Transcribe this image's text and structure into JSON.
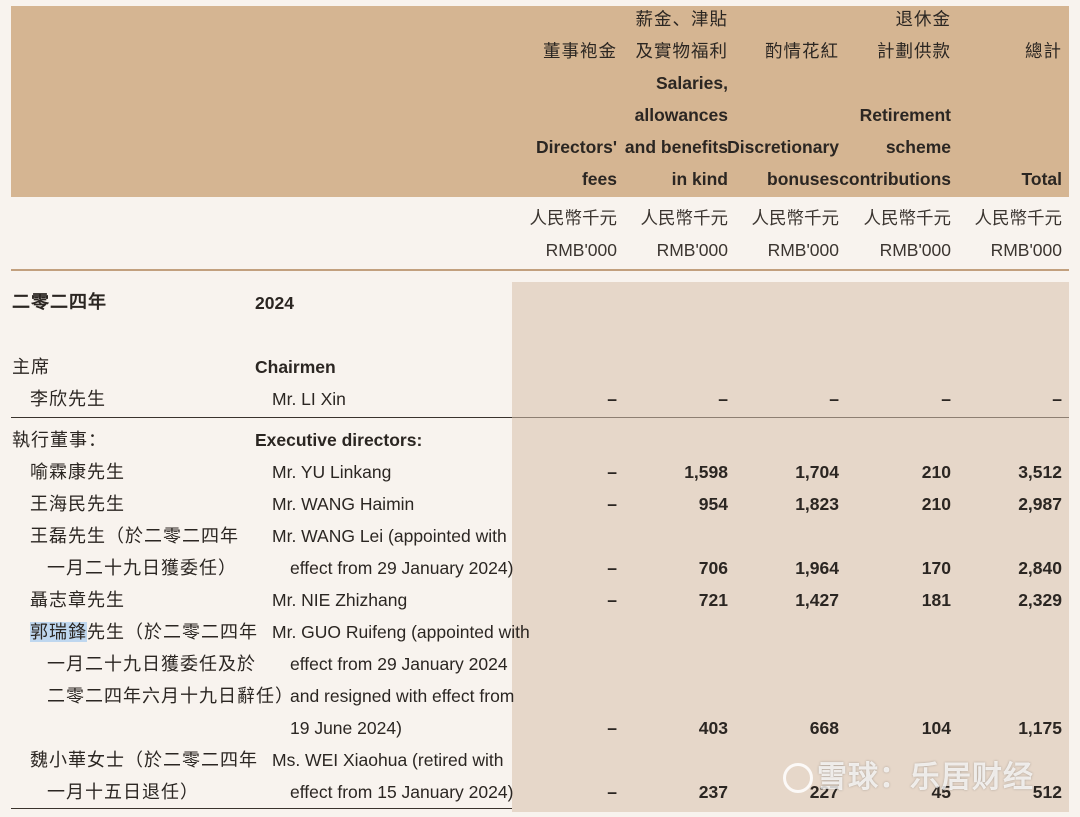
{
  "columns": [
    {
      "zh": [
        "董事袍金"
      ],
      "en": [
        "Directors'",
        "fees"
      ]
    },
    {
      "zh": [
        "薪金、津貼",
        "及實物福利"
      ],
      "en": [
        "Salaries,",
        "allowances",
        "and benefits",
        "in kind"
      ]
    },
    {
      "zh": [
        "酌情花紅"
      ],
      "en": [
        "Discretionary",
        "bonuses"
      ]
    },
    {
      "zh": [
        "退休金",
        "計劃供款"
      ],
      "en": [
        "Retirement",
        "scheme",
        "contributions"
      ]
    },
    {
      "zh": [
        "總計"
      ],
      "en": [
        "Total"
      ]
    }
  ],
  "unit": {
    "zh": "人民幣千元",
    "en": "RMB'000"
  },
  "year": {
    "zh": "二零二四年",
    "en": "2024"
  },
  "sections": {
    "chairmen": {
      "zh": "主席",
      "en": "Chairmen"
    },
    "executive": {
      "zh": "執行董事：",
      "en": "Executive directors:"
    }
  },
  "rows": [
    {
      "zh": [
        "李欣先生"
      ],
      "en": [
        "Mr. LI Xin"
      ],
      "values": [
        "–",
        "–",
        "–",
        "–",
        "–"
      ]
    },
    {
      "zh": [
        "喻霖康先生"
      ],
      "en": [
        "Mr. YU Linkang"
      ],
      "values": [
        "–",
        "1,598",
        "1,704",
        "210",
        "3,512"
      ]
    },
    {
      "zh": [
        "王海民先生"
      ],
      "en": [
        "Mr. WANG Haimin"
      ],
      "values": [
        "–",
        "954",
        "1,823",
        "210",
        "2,987"
      ]
    },
    {
      "zh": [
        "王磊先生（於二零二四年",
        "一月二十九日獲委任）"
      ],
      "en": [
        "Mr. WANG Lei (appointed with",
        "effect from 29 January 2024)"
      ],
      "values": [
        "–",
        "706",
        "1,964",
        "170",
        "2,840"
      ]
    },
    {
      "zh": [
        "聶志章先生"
      ],
      "en": [
        "Mr. NIE Zhizhang"
      ],
      "values": [
        "–",
        "721",
        "1,427",
        "181",
        "2,329"
      ]
    },
    {
      "zh_highlight": "郭瑞鋒",
      "zh": [
        "先生（於二零二四年",
        "一月二十九日獲委任及於",
        "二零二四年六月十九日辭任）"
      ],
      "en": [
        "Mr. GUO Ruifeng (appointed with",
        "effect from 29 January 2024",
        "and resigned with effect from",
        "19 June 2024)"
      ],
      "values": [
        "–",
        "403",
        "668",
        "104",
        "1,175"
      ]
    },
    {
      "zh": [
        "魏小華女士（於二零二四年",
        "一月十五日退任）"
      ],
      "en": [
        "Ms. WEI Xiaohua (retired with",
        "effect from 15 January 2024)"
      ],
      "values": [
        "–",
        "237",
        "227",
        "45",
        "512"
      ]
    }
  ],
  "watermark": "雪球：乐居财经"
}
